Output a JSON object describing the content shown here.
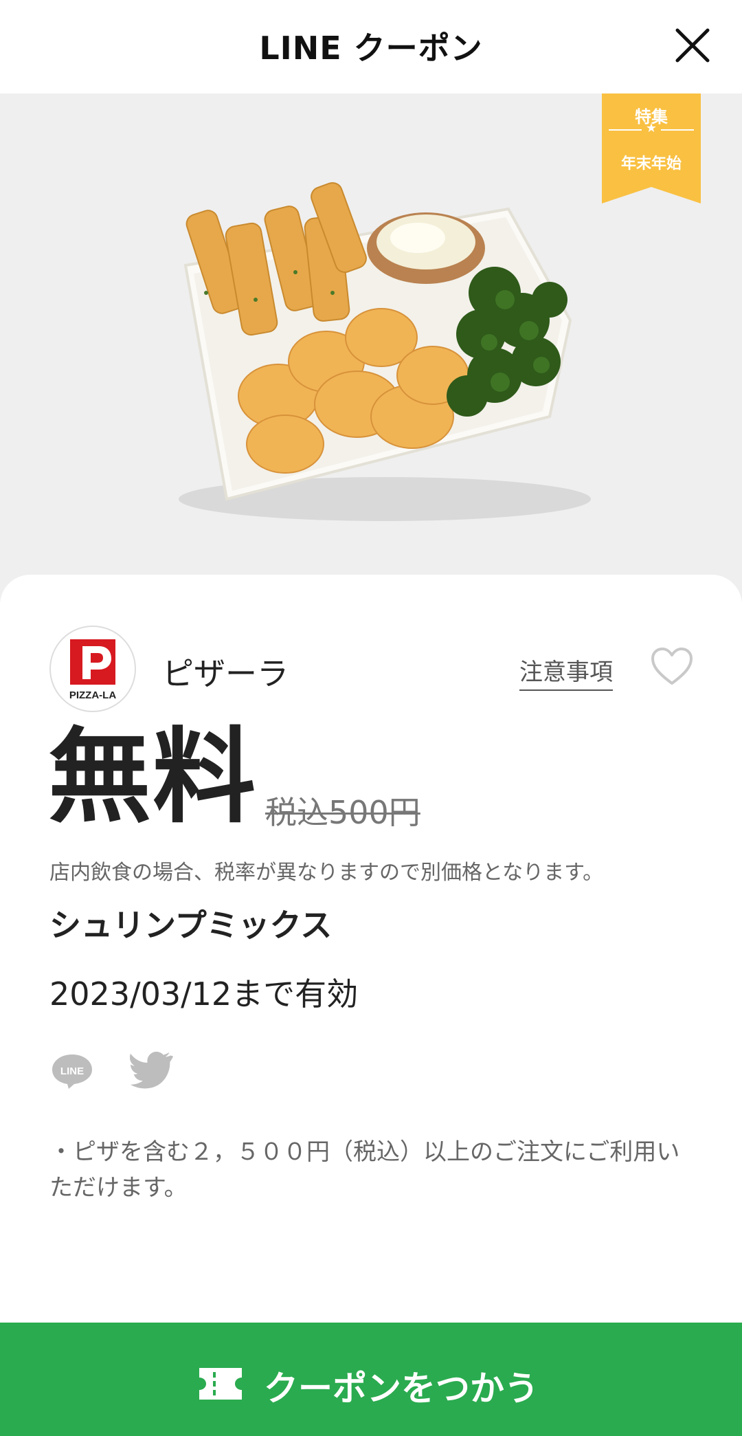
{
  "header": {
    "title": "LINE クーポン",
    "close_icon": "close-icon"
  },
  "ribbon": {
    "top": "特集",
    "bottom": "年末年始",
    "color": "#f9c042"
  },
  "store": {
    "name": "ピザーラ",
    "logo_text": "PIZZA-LA",
    "logo_letter": "P"
  },
  "notice_link": "注意事項",
  "offer": {
    "price": "無料",
    "original_price": "税込500円",
    "tax_note": "店内飲食の場合、税率が異なりますので別価格となります。",
    "product": "シュリンプミックス",
    "validity": "2023/03/12まで有効"
  },
  "share": {
    "line_label": "LINE",
    "line_icon": "line-icon",
    "twitter_icon": "twitter-icon"
  },
  "terms": "・ピザを含む２，５００円（税込）以上のご注文にご利用いただけます。",
  "cta": {
    "label": "クーポンをつかう",
    "icon": "ticket-icon",
    "color": "#2aab4f"
  }
}
